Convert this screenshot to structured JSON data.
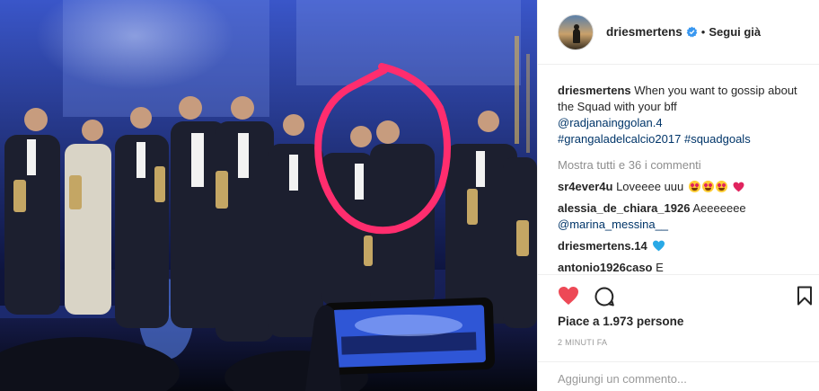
{
  "post": {
    "author": {
      "username": "driesmertens",
      "verified": true,
      "follow_separator": "•",
      "follow_label": "Segui già"
    },
    "caption": {
      "username": "driesmertens",
      "text": "When you want to gossip about the Squad with your bff",
      "mention": "@radjanainggolan.4",
      "hashtags": [
        "#grangaladelcalcio2017",
        "#squadgoals"
      ]
    },
    "view_all_comments": "Mostra tutti e 36 i commenti",
    "comments": [
      {
        "username": "sr4ever4u",
        "text": "Loveeee uuu",
        "emojis": [
          "heart-eyes-emoji",
          "heart-eyes-emoji",
          "heart-eyes-emoji",
          "red-heart-emoji"
        ]
      },
      {
        "username": "alessia_de_chiara_1926",
        "text": "Aeeeeeee",
        "mention": "@marina_messina__"
      },
      {
        "username": "driesmertens.14",
        "text": "",
        "emojis": [
          "blue-heart-emoji"
        ]
      },
      {
        "username": "antonio1926caso",
        "text": "E"
      }
    ],
    "likes_label": "Piace a 1.973 persone",
    "timestamp": "2 minuti fa",
    "add_comment_placeholder": "Aggiungi un commento...",
    "icons": {
      "like": "heart-icon",
      "comment": "comment-icon",
      "save": "bookmark-icon",
      "verified": "verified-badge-icon"
    },
    "colors": {
      "like_active": "#ed4956",
      "link": "#003569",
      "verified": "#3897f0",
      "annotation_circle": "#ff2d6e"
    }
  }
}
